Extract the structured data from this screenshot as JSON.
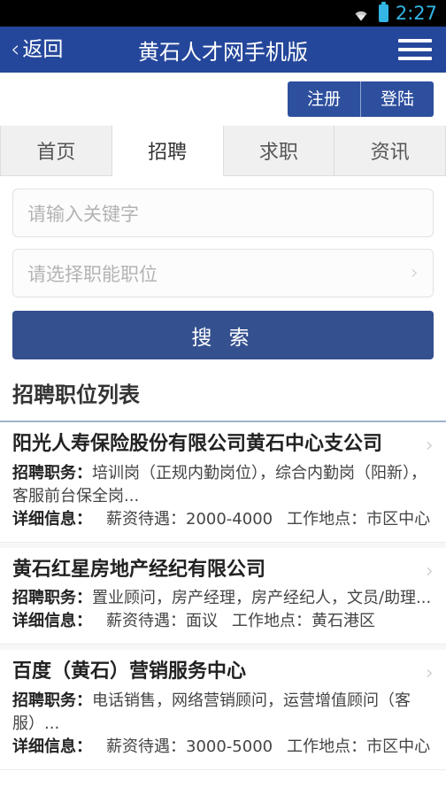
{
  "status_bar": {
    "wifi_icon": "wifi-icon",
    "battery_icon": "battery-icon",
    "time": "2:27",
    "accent_color": "#33b5e5"
  },
  "header": {
    "back_chevron": "‹",
    "back_label": "返回",
    "title": "黄石人才网手机版",
    "menu_icon": "hamburger-menu-icon",
    "background_color": "#25479b"
  },
  "auth": {
    "register_label": "注册",
    "login_label": "登陆",
    "button_color": "#2e4f9e"
  },
  "tabs": [
    {
      "label": "首页",
      "active": false
    },
    {
      "label": "招聘",
      "active": true
    },
    {
      "label": "求职",
      "active": false
    },
    {
      "label": "资讯",
      "active": false
    }
  ],
  "search_form": {
    "keyword_placeholder": "请输入关键字",
    "keyword_value": "",
    "category_label": "请选择职能职位",
    "category_chevron": "›",
    "search_button_label": "搜 索",
    "search_button_color": "#35508f"
  },
  "list_section": {
    "heading": "招聘职位列表",
    "divider_color": "#9fb3cc"
  },
  "jobs": [
    {
      "company": "阳光人寿保险股份有限公司黄石中心支公司",
      "positions_label": "招聘职务：",
      "positions": "培训岗（正规内勤岗位），综合内勤岗（阳新），客服前台保全岗...",
      "detail_label": "详细信息：",
      "salary_label": "薪资待遇：",
      "salary": "2000-4000",
      "location_label": "工作地点：",
      "location": "市区中心",
      "chevron": "›"
    },
    {
      "company": "黄石红星房地产经纪有限公司",
      "positions_label": "招聘职务：",
      "positions": "置业顾问，房产经理，房产经纪人，文员/助理...",
      "detail_label": "详细信息：",
      "salary_label": "薪资待遇：",
      "salary": "面议",
      "location_label": "工作地点：",
      "location": "黄石港区",
      "chevron": "›"
    },
    {
      "company": "百度（黄石）营销服务中心",
      "positions_label": "招聘职务：",
      "positions": "电话销售，网络营销顾问，运营增值顾问（客服）...",
      "detail_label": "详细信息：",
      "salary_label": "薪资待遇：",
      "salary": "3000-5000",
      "location_label": "工作地点：",
      "location": "市区中心",
      "chevron": "›"
    }
  ]
}
